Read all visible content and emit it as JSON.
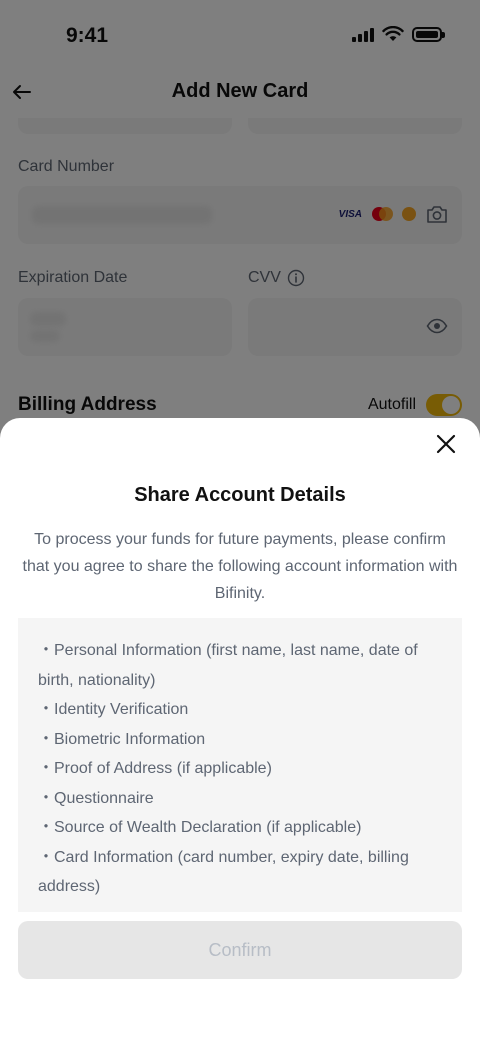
{
  "status_bar": {
    "time": "9:41"
  },
  "header": {
    "title": "Add New Card"
  },
  "form": {
    "card_number_label": "Card Number",
    "card_brand_visa": "VISA",
    "expiration_label": "Expiration Date",
    "cvv_label": "CVV",
    "billing_label": "Billing Address",
    "autofill_label": "Autofill",
    "autofill_on": true
  },
  "sheet": {
    "title": "Share Account Details",
    "description": "To process your funds for future payments, please confirm that you agree to share the following account information with Bifinity.",
    "items": [
      "・Personal Information (first name, last name, date of birth, nationality)",
      "・Identity Verification",
      "・Biometric Information",
      "・Proof of Address (if applicable)",
      "・Questionnaire",
      "・Source of Wealth Declaration (if applicable)",
      "・Card Information (card number, expiry date, billing address)"
    ],
    "confirm_label": "Confirm"
  },
  "colors": {
    "accent": "#f0b90b",
    "overlay": "rgba(0,0,0,0.5)",
    "text_secondary": "#5e6673",
    "disabled_button": "#e6e6e6"
  }
}
